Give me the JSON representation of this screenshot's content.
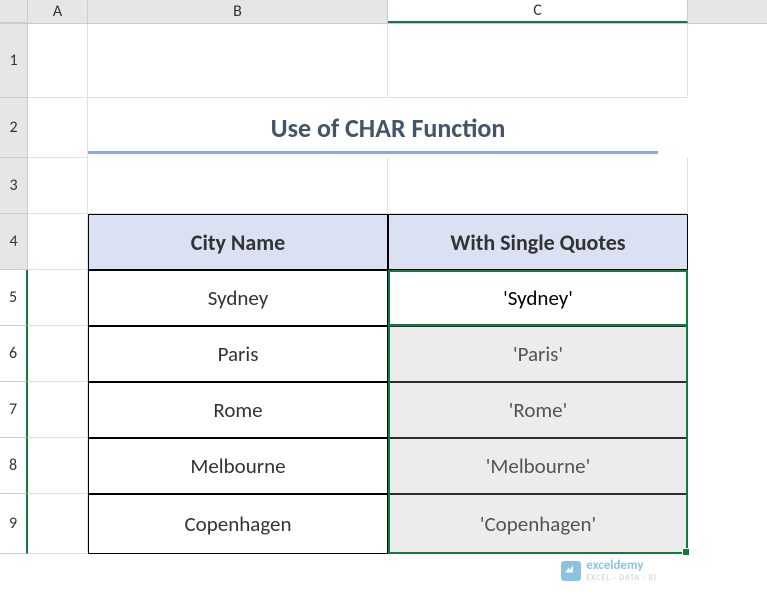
{
  "columns": [
    "A",
    "B",
    "C"
  ],
  "rows": [
    "1",
    "2",
    "3",
    "4",
    "5",
    "6",
    "7",
    "8",
    "9"
  ],
  "title": "Use of CHAR Function",
  "headers": {
    "city": "City Name",
    "quoted": "With Single Quotes"
  },
  "data": [
    {
      "city": "Sydney",
      "quoted": "'Sydney'"
    },
    {
      "city": "Paris",
      "quoted": "'Paris'"
    },
    {
      "city": "Rome",
      "quoted": "'Rome'"
    },
    {
      "city": "Melbourne",
      "quoted": "'Melbourne'"
    },
    {
      "city": "Copenhagen",
      "quoted": "'Copenhagen'"
    }
  ],
  "watermark": {
    "brand": "exceldemy",
    "tagline": "EXCEL · DATA · BI"
  },
  "chart_data": {
    "type": "table",
    "title": "Use of CHAR Function",
    "columns": [
      "City Name",
      "With Single Quotes"
    ],
    "rows": [
      [
        "Sydney",
        "'Sydney'"
      ],
      [
        "Paris",
        "'Paris'"
      ],
      [
        "Rome",
        "'Rome'"
      ],
      [
        "Melbourne",
        "'Melbourne'"
      ],
      [
        "Copenhagen",
        "'Copenhagen'"
      ]
    ]
  }
}
